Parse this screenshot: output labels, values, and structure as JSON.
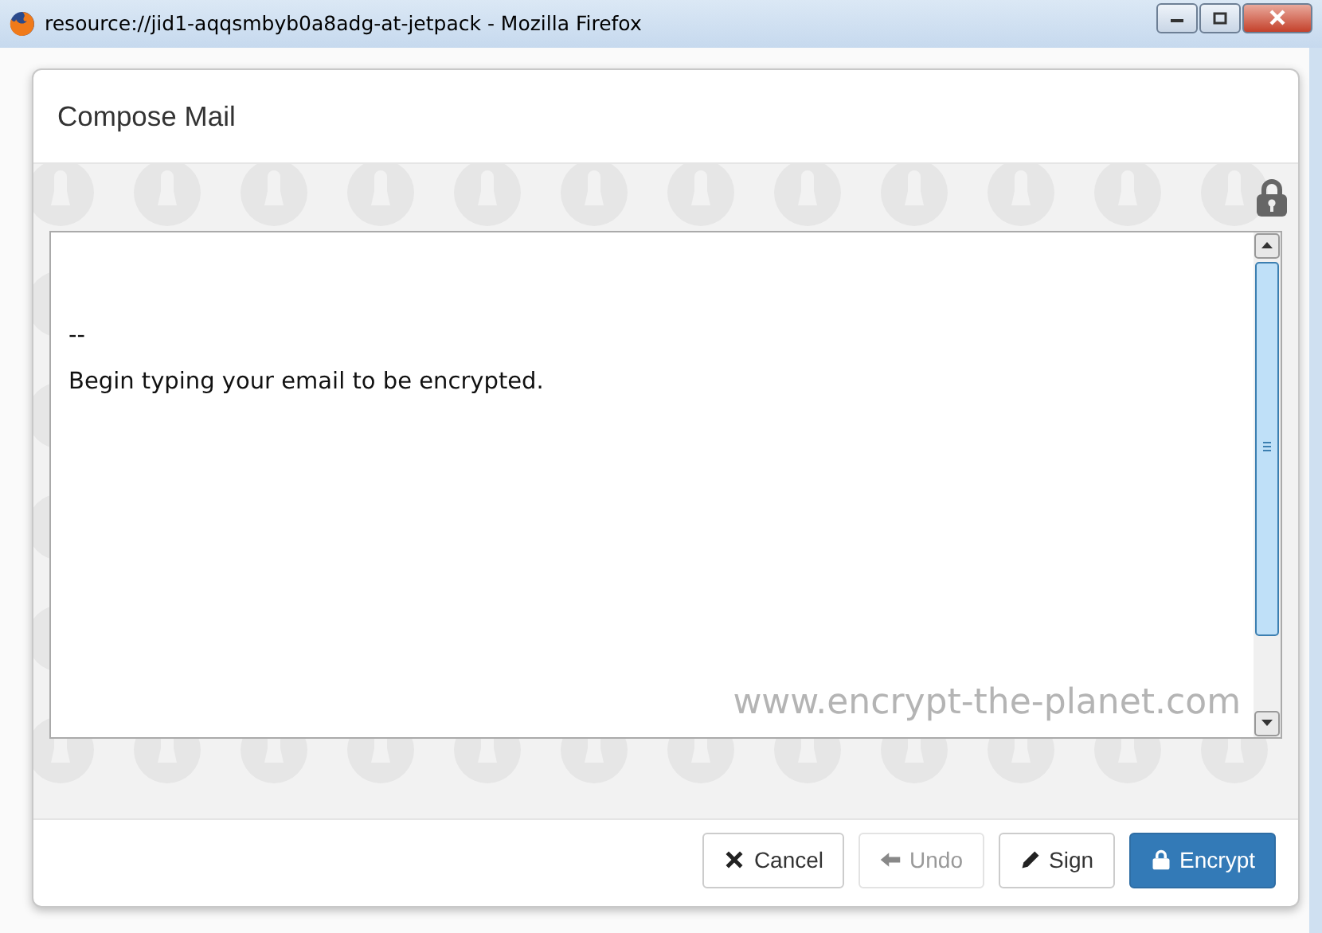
{
  "window": {
    "title": "resource://jid1-aqqsmbyb0a8adg-at-jetpack - Mozilla Firefox"
  },
  "dialog": {
    "title": "Compose Mail"
  },
  "editor": {
    "value": "\n--\nBegin typing your email to be encrypted.",
    "watermark": "www.encrypt-the-planet.com"
  },
  "buttons": [
    {
      "label": "Cancel",
      "kind": "default",
      "disabled": false
    },
    {
      "label": "Undo",
      "kind": "default",
      "disabled": true
    },
    {
      "label": "Sign",
      "kind": "default",
      "disabled": false
    },
    {
      "label": "Encrypt",
      "kind": "primary",
      "disabled": false
    }
  ]
}
